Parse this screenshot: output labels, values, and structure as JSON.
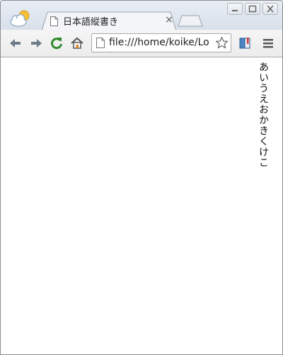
{
  "window": {
    "tab": {
      "title": "日本語縦書き",
      "close_glyph": "×"
    },
    "controls": [
      "minimize-icon",
      "maximize-icon",
      "close-icon"
    ]
  },
  "toolbar": {
    "icons": [
      "back-arrow-icon",
      "forward-arrow-icon",
      "reload-icon",
      "home-icon",
      "bookmark-star-icon",
      "extension-book-icon",
      "menu-icon"
    ],
    "address": {
      "url": "file:///home/koike/Lo"
    }
  },
  "content": {
    "vertical_text": "あいうえおかきくけこ"
  },
  "colors": {
    "reload_green": "#2e8b2e",
    "nav_arrow": "#6d7b8a",
    "home_orange": "#d9822b"
  }
}
